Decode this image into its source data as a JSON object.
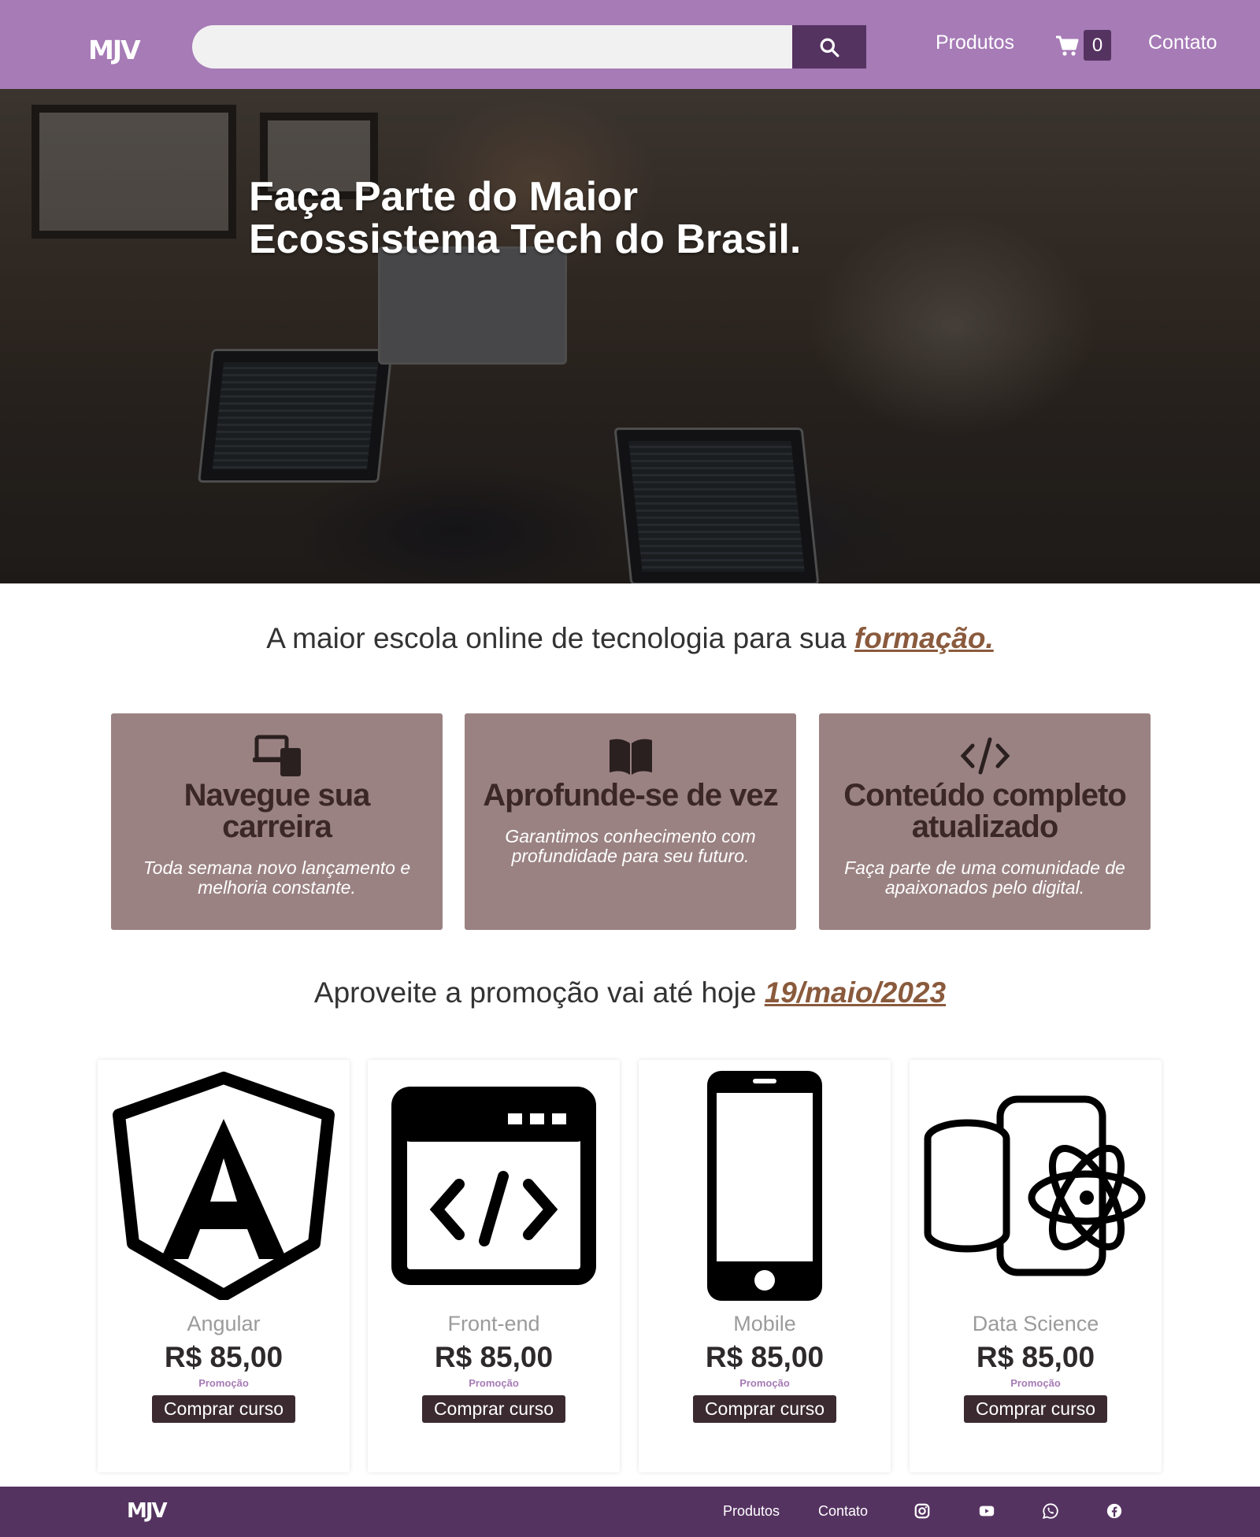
{
  "header": {
    "logo": "MJV",
    "search": {
      "value": "",
      "placeholder": ""
    },
    "nav": {
      "products": "Produtos",
      "contact": "Contato"
    },
    "cart_count": "0"
  },
  "hero": {
    "title_line1": "Faça Parte do Maior",
    "title_line2": "Ecossistema Tech do Brasil."
  },
  "tagline": {
    "text": "A maior escola online de tecnologia para sua ",
    "highlight": "formação."
  },
  "features": [
    {
      "icon": "devices-icon",
      "title": "Navegue sua carreira",
      "text": "Toda semana novo lançamento e melhoria constante."
    },
    {
      "icon": "book-icon",
      "title": "Aprofunde-se de vez",
      "text": "Garantimos conhecimento com profundidade para seu futuro."
    },
    {
      "icon": "code-icon",
      "title": "Conteúdo completo atualizado",
      "text": "Faça parte de uma comunidade de apaixonados pelo digital."
    }
  ],
  "promo": {
    "text": "Aproveite a promoção vai até hoje ",
    "date": "19/maio/2023"
  },
  "products": [
    {
      "icon": "angular-icon",
      "name": "Angular",
      "price": "R$ 85,00",
      "promo": "Promoção",
      "button": "Comprar curso"
    },
    {
      "icon": "browser-code-icon",
      "name": "Front-end",
      "price": "R$ 85,00",
      "promo": "Promoção",
      "button": "Comprar curso"
    },
    {
      "icon": "smartphone-icon",
      "name": "Mobile",
      "price": "R$ 85,00",
      "promo": "Promoção",
      "button": "Comprar curso"
    },
    {
      "icon": "data-science-icon",
      "name": "Data Science",
      "price": "R$ 85,00",
      "promo": "Promoção",
      "button": "Comprar curso"
    }
  ],
  "footer": {
    "logo": "MJV",
    "products": "Produtos",
    "contact": "Contato",
    "social": [
      "instagram-icon",
      "youtube-icon",
      "whatsapp-icon",
      "facebook-icon"
    ]
  },
  "colors": {
    "header_bg": "#a67bb6",
    "accent_dark": "#553361",
    "feature_bg": "#9b8282",
    "highlight": "#8a5a3d",
    "button_bg": "#3b2b30"
  }
}
